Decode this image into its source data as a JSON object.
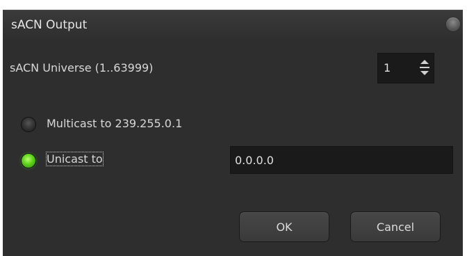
{
  "window": {
    "title": "sACN Output"
  },
  "universe": {
    "label": "sACN Universe (1..63999)",
    "value": "1"
  },
  "multicast": {
    "label": "Multicast to 239.255.0.1",
    "selected": false
  },
  "unicast": {
    "label": "Unicast to",
    "selected": true,
    "address": "0.0.0.0"
  },
  "buttons": {
    "ok_label": "OK",
    "cancel_label": "Cancel"
  },
  "colors": {
    "background": "#2e2e2e",
    "radio_active": "#5ed21a",
    "text": "#d8d8d8"
  }
}
